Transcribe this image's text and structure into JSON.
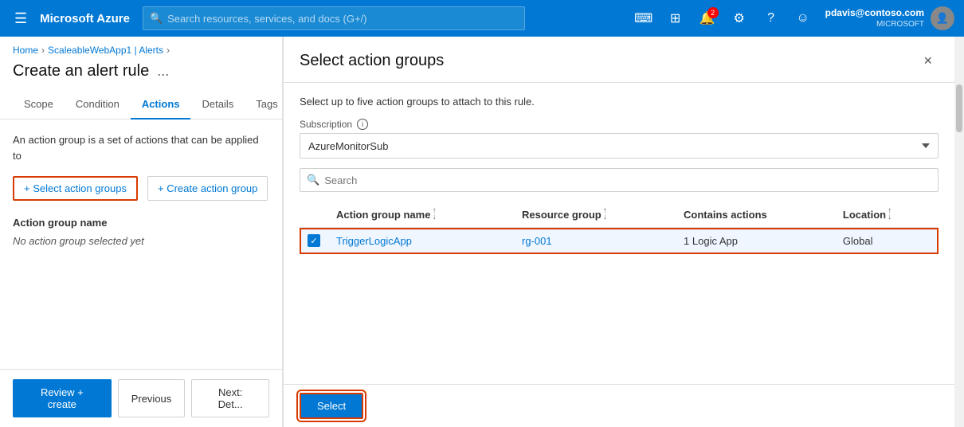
{
  "topnav": {
    "hamburger": "☰",
    "logo": "Microsoft Azure",
    "search_placeholder": "Search resources, services, and docs (G+/)",
    "notification_badge": "2",
    "user_email": "pdavis@contoso.com",
    "user_org": "MICROSOFT"
  },
  "breadcrumb": {
    "home": "Home",
    "parent": "ScaleableWebApp1 | Alerts"
  },
  "page": {
    "title": "Create an alert rule",
    "more_options": "..."
  },
  "tabs": [
    {
      "id": "scope",
      "label": "Scope"
    },
    {
      "id": "condition",
      "label": "Condition"
    },
    {
      "id": "actions",
      "label": "Actions"
    },
    {
      "id": "details",
      "label": "Details"
    },
    {
      "id": "tags",
      "label": "Tags"
    }
  ],
  "left_content": {
    "action_group_desc": "An action group is a set of actions that can be applied to",
    "select_btn_label": "+ Select action groups",
    "create_btn_label": "+ Create action group",
    "table_header": "Action group name",
    "no_action_text": "No action group selected yet"
  },
  "bottom_buttons": {
    "review_create": "Review + create",
    "previous": "Previous",
    "next": "Next: Det..."
  },
  "dialog": {
    "title": "Select action groups",
    "close_label": "×",
    "description": "Select up to five action groups to attach to this rule.",
    "subscription_label": "Subscription",
    "subscription_info": "ℹ",
    "subscription_value": "AzureMonitorSub",
    "search_placeholder": "Search",
    "table": {
      "columns": [
        {
          "id": "name",
          "label": "Action group name",
          "sortable": true
        },
        {
          "id": "resource_group",
          "label": "Resource group",
          "sortable": true
        },
        {
          "id": "contains_actions",
          "label": "Contains actions",
          "sortable": false
        },
        {
          "id": "location",
          "label": "Location",
          "sortable": true
        }
      ],
      "rows": [
        {
          "selected": true,
          "name": "TriggerLogicApp",
          "resource_group": "rg-001",
          "contains_actions": "1 Logic App",
          "location": "Global"
        }
      ]
    },
    "select_button": "Select"
  }
}
